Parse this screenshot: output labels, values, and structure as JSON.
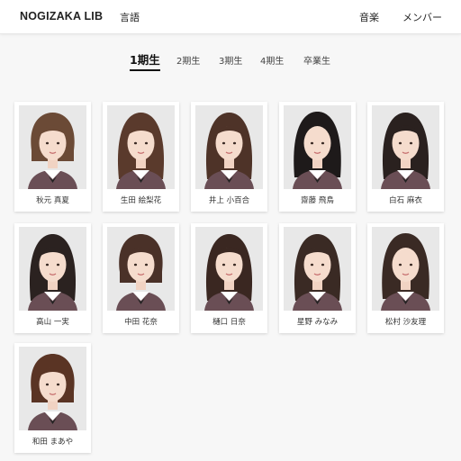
{
  "header": {
    "brand": "NOGIZAKA LIB",
    "nav": [
      "言語",
      "音楽",
      "メンバー"
    ]
  },
  "tabs": [
    {
      "label": "1期生",
      "active": true
    },
    {
      "label": "2期生",
      "active": false
    },
    {
      "label": "3期生",
      "active": false
    },
    {
      "label": "4期生",
      "active": false
    },
    {
      "label": "卒業生",
      "active": false
    }
  ],
  "members": [
    {
      "name": "秋元 真夏",
      "hair": "#6b4a36",
      "style": "bob"
    },
    {
      "name": "生田 絵梨花",
      "hair": "#5a3a2c",
      "style": "long"
    },
    {
      "name": "井上 小百合",
      "hair": "#4e3328",
      "style": "long"
    },
    {
      "name": "齋藤 飛鳥",
      "hair": "#1e1a1a",
      "style": "bangs"
    },
    {
      "name": "白石 麻衣",
      "hair": "#2a211f",
      "style": "long"
    },
    {
      "name": "高山 一実",
      "hair": "#2b2220",
      "style": "long"
    },
    {
      "name": "中田 花奈",
      "hair": "#4a3128",
      "style": "bob"
    },
    {
      "name": "樋口 日奈",
      "hair": "#3a2721",
      "style": "long"
    },
    {
      "name": "星野 みなみ",
      "hair": "#3a2a24",
      "style": "long"
    },
    {
      "name": "松村 沙友理",
      "hair": "#3a2a24",
      "style": "bangs"
    },
    {
      "name": "和田 まあや",
      "hair": "#5a3424",
      "style": "bob"
    }
  ]
}
